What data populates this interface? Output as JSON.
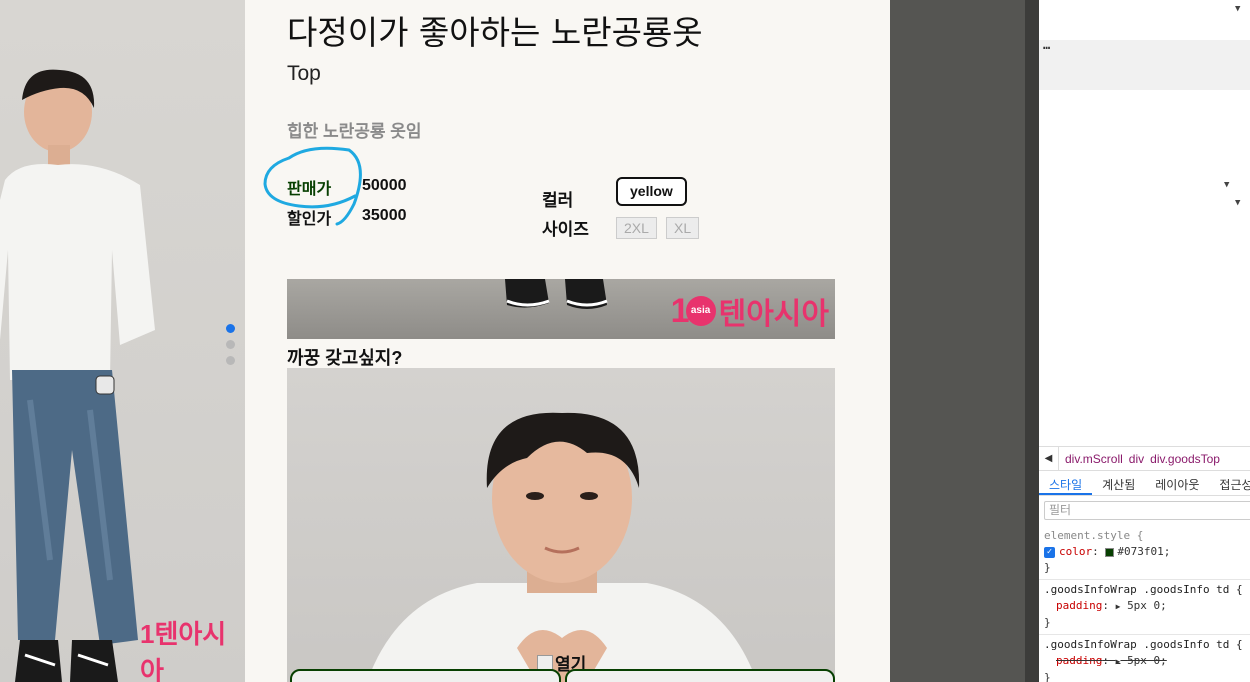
{
  "product": {
    "title": "다정이가 좋아하는 노란공룡옷",
    "category": "Top",
    "description": "힙한 노란공룡 옷임",
    "sale_label": "판매가",
    "sale_price": "50000",
    "discount_label": "할인가",
    "discount_price": "35000",
    "color_label": "컬러",
    "color_option": "yellow",
    "size_label": "사이즈",
    "size_options": [
      "2XL",
      "XL"
    ],
    "question": "까꿍 갖고싶지?",
    "open_label": "열기",
    "banner_logo": {
      "one": "1",
      "asia": "asia",
      "text": "텐아시아"
    }
  },
  "slider": {
    "dot_count": 3,
    "active_index": 0
  },
  "devtools": {
    "ellipsis": "…",
    "breadcrumbs": [
      "div.mScroll",
      "div",
      "div.goodsTop"
    ],
    "tabs": [
      "스타일",
      "계산됨",
      "레이아웃",
      "접근성"
    ],
    "active_tab": "스타일",
    "filter_placeholder": "필터",
    "element_style_selector": "element.style {",
    "color_prop": "color",
    "color_value": "#073f01;",
    "close_brace": "}",
    "rule1_selector": ".goodsInfoWrap .goodsInfo td {",
    "rule1_prop": "padding",
    "rule1_value": "5px 0;",
    "rule2_selector": ".goodsInfoWrap .goodsInfo td {",
    "rule2_prop": "padding",
    "rule2_value": "5px 0;"
  },
  "colors": {
    "sale_label": "#073f01",
    "brand_pink": "#e8336d",
    "annotation_circle": "#1fa9e1",
    "active_tab": "#1a73e8"
  }
}
